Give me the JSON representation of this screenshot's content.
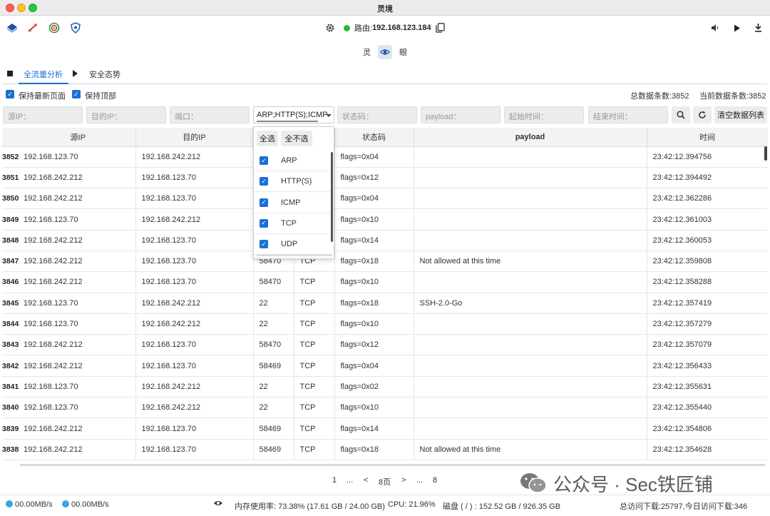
{
  "window": {
    "title": "灵境"
  },
  "toolbar": {
    "left_icons": [
      "stack-icon",
      "rocket-icon",
      "target-icon",
      "shield-icon"
    ],
    "route_label": "路由:",
    "route_ip": "192.168.123.184",
    "right_icons": [
      "volume-icon",
      "play-icon",
      "download-icon"
    ]
  },
  "subhead": {
    "left": "灵",
    "right": "眼"
  },
  "tabs": [
    {
      "label": "全流量分析",
      "active": true
    },
    {
      "label": "安全态势",
      "active": false
    }
  ],
  "options": {
    "keep_latest": "保持最新页面",
    "keep_top": "保持顶部",
    "total_label": "总数据条数:3852",
    "current_label": "当前数据条数:3852"
  },
  "filters": {
    "src_ip": "源IP：",
    "dst_ip": "目的IP：",
    "port": "端口：",
    "protocol_value": "ARP;HTTP(S);ICMP",
    "status": "状态码：",
    "payload": "payload：",
    "start_time": "起始时间：",
    "end_time": "结束时间：",
    "clear_button": "清空数据列表"
  },
  "dropdown": {
    "select_all": "全选",
    "select_none": "全不选",
    "items": [
      {
        "label": "ARP",
        "checked": true
      },
      {
        "label": "HTTP(S)",
        "checked": true
      },
      {
        "label": "ICMP",
        "checked": true
      },
      {
        "label": "TCP",
        "checked": true
      },
      {
        "label": "UDP",
        "checked": true
      }
    ]
  },
  "table": {
    "columns": [
      "",
      "源IP",
      "目的IP",
      "",
      "",
      "状态码",
      "payload",
      "时间"
    ],
    "rows": [
      {
        "id": "3852",
        "src": "192.168.123.70",
        "dst": "192.168.242.212",
        "port": "",
        "proto": "",
        "status": "flags=0x04",
        "payload": "",
        "time": "23:42:12.394756"
      },
      {
        "id": "3851",
        "src": "192.168.242.212",
        "dst": "192.168.123.70",
        "port": "",
        "proto": "",
        "status": "flags=0x12",
        "payload": "",
        "time": "23:42:12.394492"
      },
      {
        "id": "3850",
        "src": "192.168.242.212",
        "dst": "192.168.123.70",
        "port": "",
        "proto": "",
        "status": "flags=0x04",
        "payload": "",
        "time": "23:42:12.362286"
      },
      {
        "id": "3849",
        "src": "192.168.123.70",
        "dst": "192.168.242.212",
        "port": "",
        "proto": "",
        "status": "flags=0x10",
        "payload": "",
        "time": "23:42:12.361003"
      },
      {
        "id": "3848",
        "src": "192.168.242.212",
        "dst": "192.168.123.70",
        "port": "",
        "proto": "",
        "status": "flags=0x14",
        "payload": "",
        "time": "23:42:12.360053"
      },
      {
        "id": "3847",
        "src": "192.168.242.212",
        "dst": "192.168.123.70",
        "port": "58470",
        "proto": "TCP",
        "status": "flags=0x18",
        "payload": "Not allowed at this time",
        "time": "23:42:12.359808"
      },
      {
        "id": "3846",
        "src": "192.168.242.212",
        "dst": "192.168.123.70",
        "port": "58470",
        "proto": "TCP",
        "status": "flags=0x10",
        "payload": "",
        "time": "23:42:12.358288"
      },
      {
        "id": "3845",
        "src": "192.168.123.70",
        "dst": "192.168.242.212",
        "port": "22",
        "proto": "TCP",
        "status": "flags=0x18",
        "payload": "SSH-2.0-Go",
        "time": "23:42:12.357419"
      },
      {
        "id": "3844",
        "src": "192.168.123.70",
        "dst": "192.168.242.212",
        "port": "22",
        "proto": "TCP",
        "status": "flags=0x10",
        "payload": "",
        "time": "23:42:12.357279"
      },
      {
        "id": "3843",
        "src": "192.168.242.212",
        "dst": "192.168.123.70",
        "port": "58470",
        "proto": "TCP",
        "status": "flags=0x12",
        "payload": "",
        "time": "23:42:12.357079"
      },
      {
        "id": "3842",
        "src": "192.168.242.212",
        "dst": "192.168.123.70",
        "port": "58469",
        "proto": "TCP",
        "status": "flags=0x04",
        "payload": "",
        "time": "23:42:12.356433"
      },
      {
        "id": "3841",
        "src": "192.168.123.70",
        "dst": "192.168.242.212",
        "port": "22",
        "proto": "TCP",
        "status": "flags=0x02",
        "payload": "",
        "time": "23:42:12.355631"
      },
      {
        "id": "3840",
        "src": "192.168.123.70",
        "dst": "192.168.242.212",
        "port": "22",
        "proto": "TCP",
        "status": "flags=0x10",
        "payload": "",
        "time": "23:42:12.355440"
      },
      {
        "id": "3839",
        "src": "192.168.242.212",
        "dst": "192.168.123.70",
        "port": "58469",
        "proto": "TCP",
        "status": "flags=0x14",
        "payload": "",
        "time": "23:42:12.354806"
      },
      {
        "id": "3838",
        "src": "192.168.242.212",
        "dst": "192.168.123.70",
        "port": "58469",
        "proto": "TCP",
        "status": "flags=0x18",
        "payload": "Not allowed at this time",
        "time": "23:42:12.354628"
      }
    ]
  },
  "pager": {
    "first": "1",
    "ellipsis1": "...",
    "prev": "<",
    "current": "8页",
    "next": ">",
    "ellipsis2": "...",
    "last": "8"
  },
  "watermark": {
    "text": "公众号 · Sec铁匠铺"
  },
  "status": {
    "upload": "00.00MB/s",
    "download": "00.00MB/s",
    "memory": "内存使用率: 73.38% (17.61 GB / 24.00 GB)",
    "cpu": "CPU: 21.96%",
    "disk": "磁盘 ( / ) : 152.52 GB / 926.35 GB",
    "visits": "总访问下载:25797,今日访问下载:346"
  },
  "colors": {
    "accent": "#1a6fd6",
    "online": "#22bb33"
  }
}
